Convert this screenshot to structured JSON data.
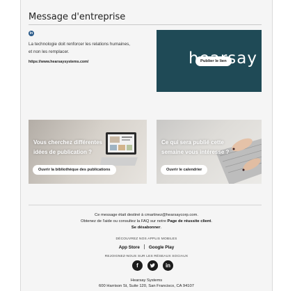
{
  "header": {
    "title": "Message d'entreprise"
  },
  "post": {
    "network_icon": "linkedin-icon",
    "text_line1": "La technologie doit renforcer les relations humaines,",
    "text_line2": "et non les remplacer.",
    "link": "https://www.hearsaysystems.com/"
  },
  "hero": {
    "brand_text": "hearsay",
    "button": "Publier le lien",
    "bg_color": "#1f4a56"
  },
  "cards": [
    {
      "title_line1": "Vous cherchez différentes",
      "title_line2": "idées de publication ?",
      "button": "Ouvrir la bibliothèque des publications"
    },
    {
      "title_line1": "Ce qui sera publié cette",
      "title_line2": "semaine vous intéresse ?",
      "button": "Ouvrir le calendrier"
    }
  ],
  "footer": {
    "sent_to": "Ce message était destiné à cmartinez@hearsaycorp.com.",
    "help_prefix": "Obtenez de l'aide ou consultez la FAQ sur notre ",
    "help_link": "Page de réussite client",
    "help_suffix": ".",
    "unsubscribe": "Se désabonner",
    "unsubscribe_suffix": ".",
    "apps_heading": "DÉCOUVREZ NOS APPLIS MOBILES",
    "app_store": "App Store",
    "google_play": "Google Play",
    "social_heading": "REJOIGNEZ-NOUS SUR LES RÉSEAUX SOCIAUX",
    "social_icons": [
      "facebook-icon",
      "twitter-icon",
      "linkedin-icon"
    ],
    "company": "Hearsay Systems",
    "address": "600 Harrison St, Suite 120, San Francisco, CA 94107"
  }
}
